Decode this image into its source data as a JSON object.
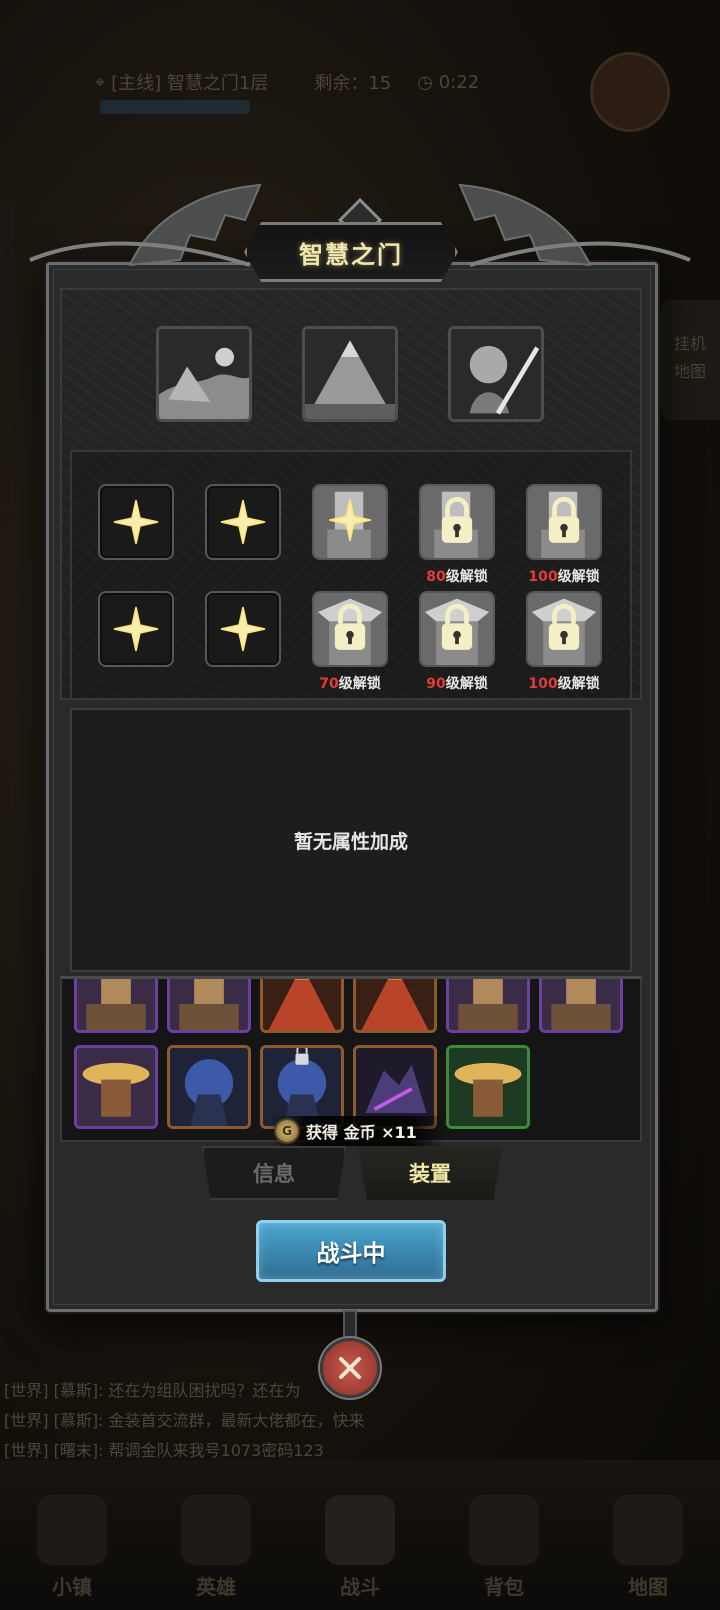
{
  "background": {
    "location": "[主线] 智慧之门1层",
    "remaining_label": "剩余：",
    "remaining_value": "15",
    "timer": "0:22",
    "side_right": [
      "挂机",
      "地图"
    ],
    "chat": [
      "[世界] [慕斯]: 还在为组队困扰吗？还在为",
      "[世界] [慕斯]: 金装首交流群，最新大佬都在，快来",
      "[世界] [曙末]: 帮调金队来我号1073密码123"
    ],
    "nav": [
      "小镇",
      "英雄",
      "战斗",
      "背包",
      "地图"
    ]
  },
  "modal": {
    "title": "智慧之门",
    "slots_row1": [
      {
        "state": "open"
      },
      {
        "state": "open"
      },
      {
        "state": "open_portrait"
      },
      {
        "state": "locked",
        "level": "80",
        "suffix": "级解锁"
      },
      {
        "state": "locked",
        "level": "100",
        "suffix": "级解锁"
      }
    ],
    "slots_row2": [
      {
        "state": "open"
      },
      {
        "state": "open"
      },
      {
        "state": "locked",
        "level": "70",
        "suffix": "级解锁"
      },
      {
        "state": "locked",
        "level": "90",
        "suffix": "级解锁"
      },
      {
        "state": "locked",
        "level": "100",
        "suffix": "级解锁"
      }
    ],
    "attr_text": "暂无属性加成",
    "reward_toast": {
      "text": "获得 金币 ×11",
      "coin_icon": "G"
    },
    "tabs": {
      "info": "信息",
      "equip": "装置"
    },
    "fight_button": "战斗中"
  }
}
